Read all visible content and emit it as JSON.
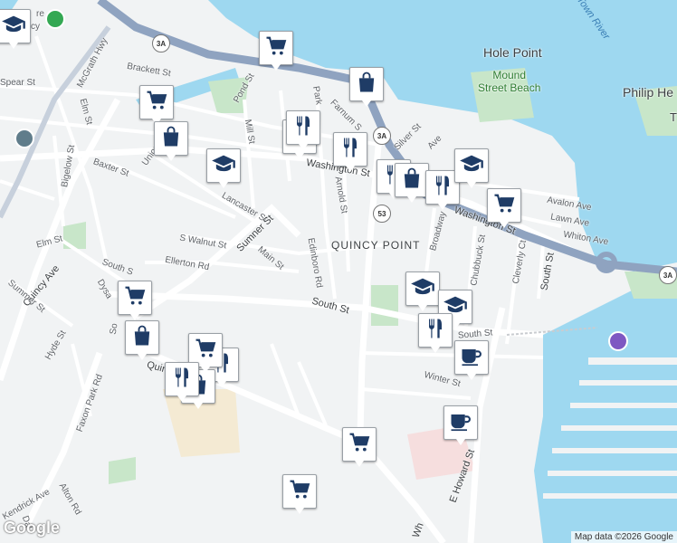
{
  "map": {
    "labels": {
      "hole_point": "Hole Point",
      "mound_street_beach": "Mound\nStreet Beach",
      "philip_he": "Philip He",
      "town_river": "Town River",
      "quincy_point": "QUINCY POINT",
      "mcgrath_hwy": "McGrath Hwy",
      "brackett_st": "Brackett St",
      "spear_st": "Spear St",
      "elm_st_1": "Elm St",
      "pond_st": "Pond St",
      "mill_st": "Mill St",
      "park": "Park",
      "farnum": "Farnum S",
      "silver_st": "Silver St",
      "ave": "Ave",
      "washington_st_1": "Washington St",
      "washington_st_2": "Washington St",
      "union_s": "Union S",
      "baxter_st": "Baxter St",
      "bigelow_st": "Bigelow St",
      "lancaster_st": "Lancaster St",
      "arnold_st": "Arnold St",
      "summer_st_1": "Sumner St",
      "s_walnut_st": "S Walnut St",
      "main_st": "Main St",
      "ellerton_rd": "Ellerton Rd",
      "edinboro_rd": "Edinboro Rd",
      "elm_st_2": "Elm St",
      "broadway": "Broadway",
      "chubbuck_st": "Chubbuck St",
      "cleverly_ct": "Cleverly Ct",
      "south_st_1": "South St",
      "south_st_2": "South St",
      "south_st_3": "South St",
      "avalon_ave": "Avalon Ave",
      "lawn_ave": "Lawn Ave",
      "whiton_ave": "Whiton Ave",
      "quincy_ave": "Quincy Ave",
      "summer_st_2": "Summer St",
      "dysart": "Dysa",
      "south_s": "South S",
      "so": "So",
      "hyde_st": "Hyde St",
      "quin": "Quin",
      "faxon_park_rd": "Faxon Park Rd",
      "winter_st": "Winter St",
      "south_st_4": "South St",
      "e_howard_st": "E Howard St",
      "kendrick_ave": "Kendrick Ave",
      "alton_rd": "Alton Rd",
      "dal": "Dal",
      "wh": "Wh",
      "re": "re",
      "cy": "cy",
      "t": "T"
    },
    "shields": [
      "3A",
      "3A",
      "53",
      "3A"
    ],
    "attribution": "Map data ©2026 Google",
    "logo": "Google"
  },
  "pins": [
    {
      "icon": "school"
    },
    {
      "icon": "grocery"
    },
    {
      "icon": "shopping-bag"
    },
    {
      "icon": "grocery"
    },
    {
      "icon": "shopping-bag"
    },
    {
      "icon": "school"
    },
    {
      "icon": "restaurant"
    },
    {
      "icon": "restaurant"
    },
    {
      "icon": "restaurant"
    },
    {
      "icon": "restaurant"
    },
    {
      "icon": "shopping-bag"
    },
    {
      "icon": "restaurant"
    },
    {
      "icon": "school"
    },
    {
      "icon": "grocery"
    },
    {
      "icon": "school"
    },
    {
      "icon": "school"
    },
    {
      "icon": "restaurant"
    },
    {
      "icon": "cafe"
    },
    {
      "icon": "cafe"
    },
    {
      "icon": "grocery"
    },
    {
      "icon": "shopping-bag"
    },
    {
      "icon": "grocery"
    },
    {
      "icon": "restaurant"
    },
    {
      "icon": "shopping-bag"
    },
    {
      "icon": "grocery"
    },
    {
      "icon": "grocery"
    },
    {
      "icon": "restaurant"
    }
  ],
  "colors": {
    "water": "#9ed8f0",
    "land": "#f1f3f4",
    "park": "#c8e6c9",
    "highway": "#8fa3c0",
    "pin_icon": "#1f3c66"
  }
}
